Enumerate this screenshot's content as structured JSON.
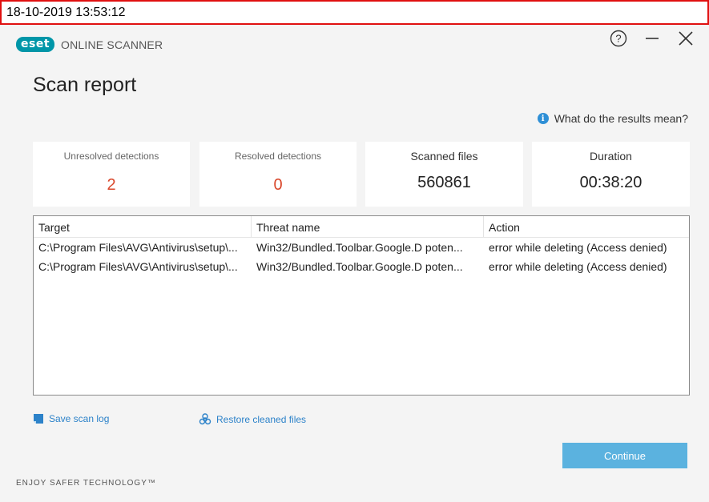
{
  "timestamp": "18-10-2019 13:53:12",
  "brand": {
    "logo_text": "eset",
    "product": "ONLINE SCANNER",
    "accent_color": "#0096a8"
  },
  "window_controls": {
    "help_icon": "question-circle-icon",
    "minimize_icon": "minimize-icon",
    "close_icon": "close-icon"
  },
  "page_title": "Scan report",
  "help_link": "What do the results mean?",
  "stats": [
    {
      "label": "Unresolved detections",
      "value": "2"
    },
    {
      "label": "Resolved detections",
      "value": "0"
    },
    {
      "label": "Scanned files",
      "value": "560861"
    },
    {
      "label": "Duration",
      "value": "00:38:20"
    }
  ],
  "table": {
    "columns": [
      "Target",
      "Threat name",
      "Action"
    ],
    "rows": [
      [
        "C:\\Program Files\\AVG\\Antivirus\\setup\\...",
        "Win32/Bundled.Toolbar.Google.D poten...",
        "error while deleting (Access denied)"
      ],
      [
        "C:\\Program Files\\AVG\\Antivirus\\setup\\...",
        "Win32/Bundled.Toolbar.Google.D poten...",
        "error while deleting (Access denied)"
      ]
    ]
  },
  "links": {
    "save_log": "Save scan log",
    "restore": "Restore cleaned files"
  },
  "continue_label": "Continue",
  "footer": "ENJOY SAFER TECHNOLOGY™",
  "colors": {
    "unresolved": "#d9472b",
    "resolved": "#d9472b",
    "link": "#2c82c9",
    "button": "#5bb2df"
  }
}
